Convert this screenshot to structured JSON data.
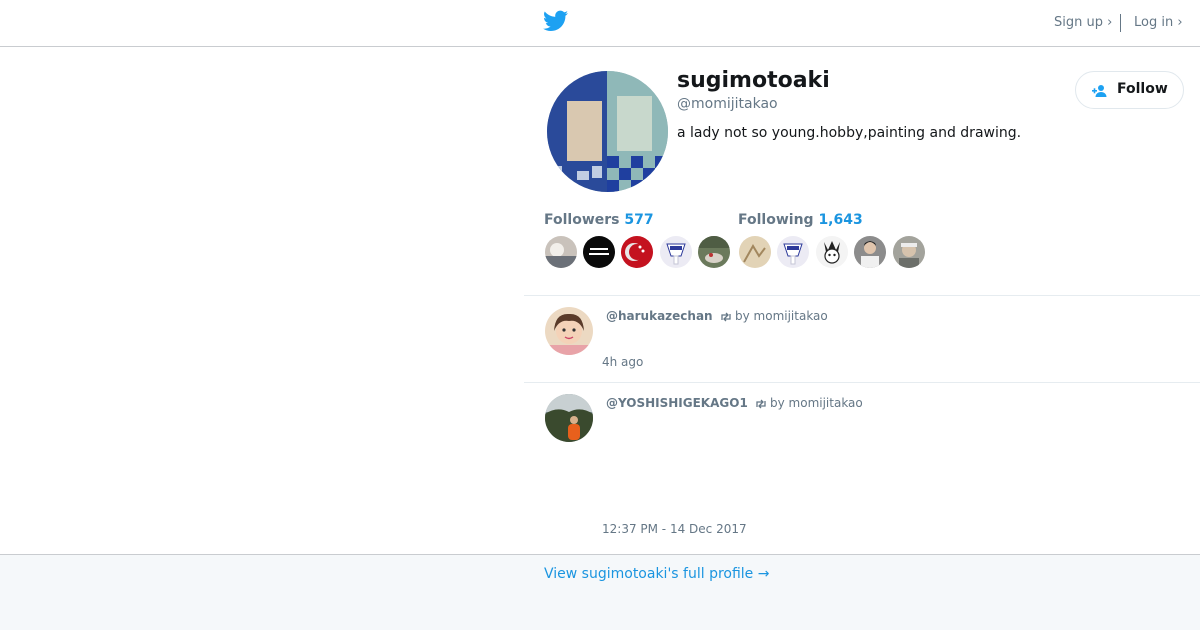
{
  "header": {
    "logo_icon": "twitter-bird-icon",
    "signup_label": "Sign up ›",
    "login_label": "Log in ›"
  },
  "profile": {
    "name": "sugimotoaki",
    "handle": "@momijitakao",
    "bio": "a lady not so young.hobby,painting and drawing.",
    "follow_label": "Follow",
    "follow_icon": "add-user-icon"
  },
  "stats": {
    "followers_label": "Followers",
    "followers_count": "577",
    "following_label": "Following",
    "following_count": "1,643"
  },
  "followers_avatars": [
    "avatar-1",
    "avatar-2",
    "avatar-3",
    "avatar-4",
    "avatar-5"
  ],
  "following_avatars": [
    "avatar-6",
    "avatar-7",
    "avatar-8",
    "avatar-9",
    "avatar-10"
  ],
  "tweets": [
    {
      "user": "@harukazechan",
      "retweet_by": "by momijitakao",
      "retweet_icon": "retweet-icon",
      "time": "4h ago"
    },
    {
      "user": "@YOSHISHIGEKAGO1",
      "retweet_by": "by momijitakao",
      "retweet_icon": "retweet-icon",
      "time": "12:37 PM - 14 Dec 2017"
    }
  ],
  "footer": {
    "link_label": "View sugimotoaki's full profile →"
  },
  "colors": {
    "accent": "#1b95e0",
    "twitter_blue": "#1da1f2",
    "muted_text": "#657786",
    "footer_bg": "#f5f8fa"
  }
}
